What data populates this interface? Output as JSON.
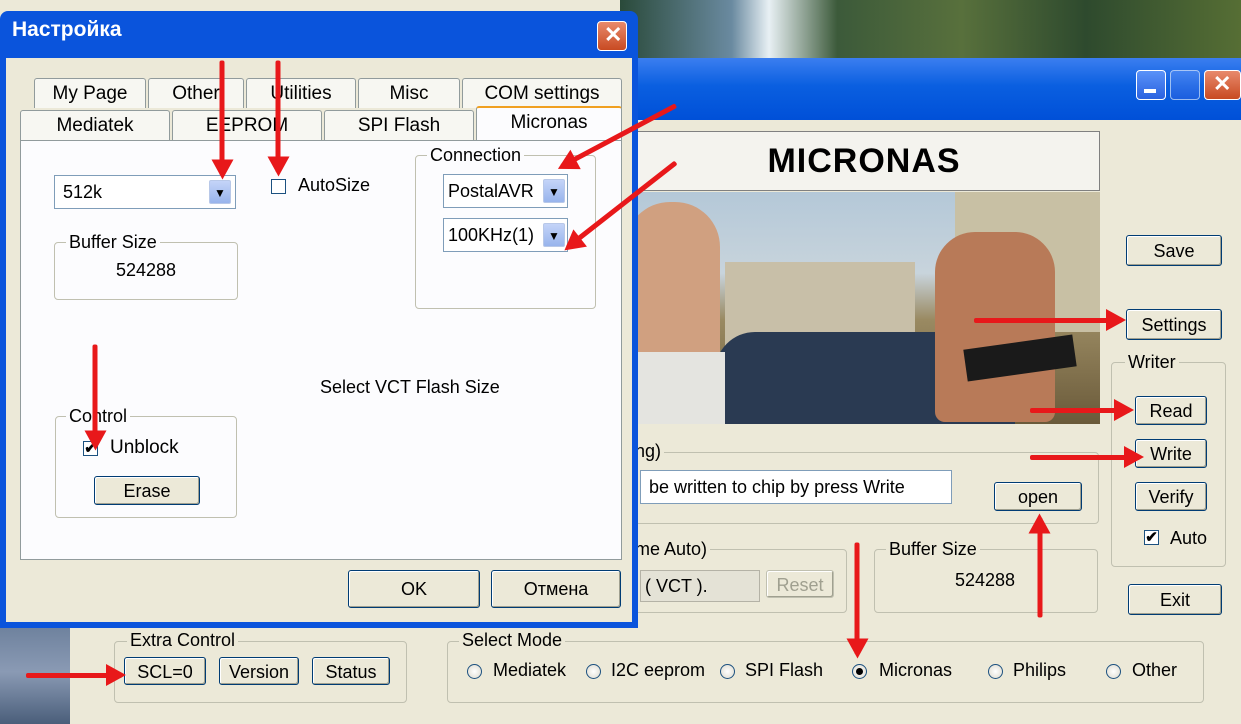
{
  "colors": {
    "accent": "#0a54dc",
    "annotation": "#e8181a",
    "window_bg": "#ece9d8"
  },
  "main": {
    "header_title": "MICRONAS",
    "save_label": "Save",
    "settings_label": "Settings",
    "writer_label": "Writer",
    "read_label": "Read",
    "write_label": "Write",
    "verify_label": "Verify",
    "auto_label": "Auto",
    "exit_label": "Exit",
    "file_group_label": "ng)",
    "file_field_value": "be written to chip by press Write",
    "open_label": "open",
    "name_group_label": "me Auto)",
    "name_value": "( VCT ).",
    "reset_label": "Reset",
    "buffer_group_label": "Buffer Size",
    "buffer_value": "524288",
    "extra_control_label": "Extra Control",
    "scl_label": "SCL=0",
    "version_label": "Version",
    "status_label": "Status",
    "select_mode_label": "Select Mode",
    "modes": [
      "Mediatek",
      "I2C eeprom",
      "SPI Flash",
      "Micronas",
      "Philips",
      "Other"
    ],
    "selected_mode": "Micronas"
  },
  "dialog": {
    "title": "Настройка",
    "tabs_row1": [
      "My Page",
      "Other",
      "Utilities",
      "Misc",
      "COM settings"
    ],
    "tabs_row2": [
      "Mediatek",
      "EEPROM",
      "SPI Flash",
      "Micronas"
    ],
    "active_tab": "Micronas",
    "flash_size_value": "512k",
    "autosize_label": "AutoSize",
    "buffer_group_label": "Buffer Size",
    "buffer_value": "524288",
    "connection_label": "Connection",
    "connection_value": "PostalAVR",
    "speed_value": "100KHz(1)",
    "hint_text": "Select VCT Flash Size",
    "control_label": "Control",
    "unblock_label": "Unblock",
    "erase_label": "Erase",
    "ok_label": "OK",
    "cancel_label": "Отмена"
  }
}
